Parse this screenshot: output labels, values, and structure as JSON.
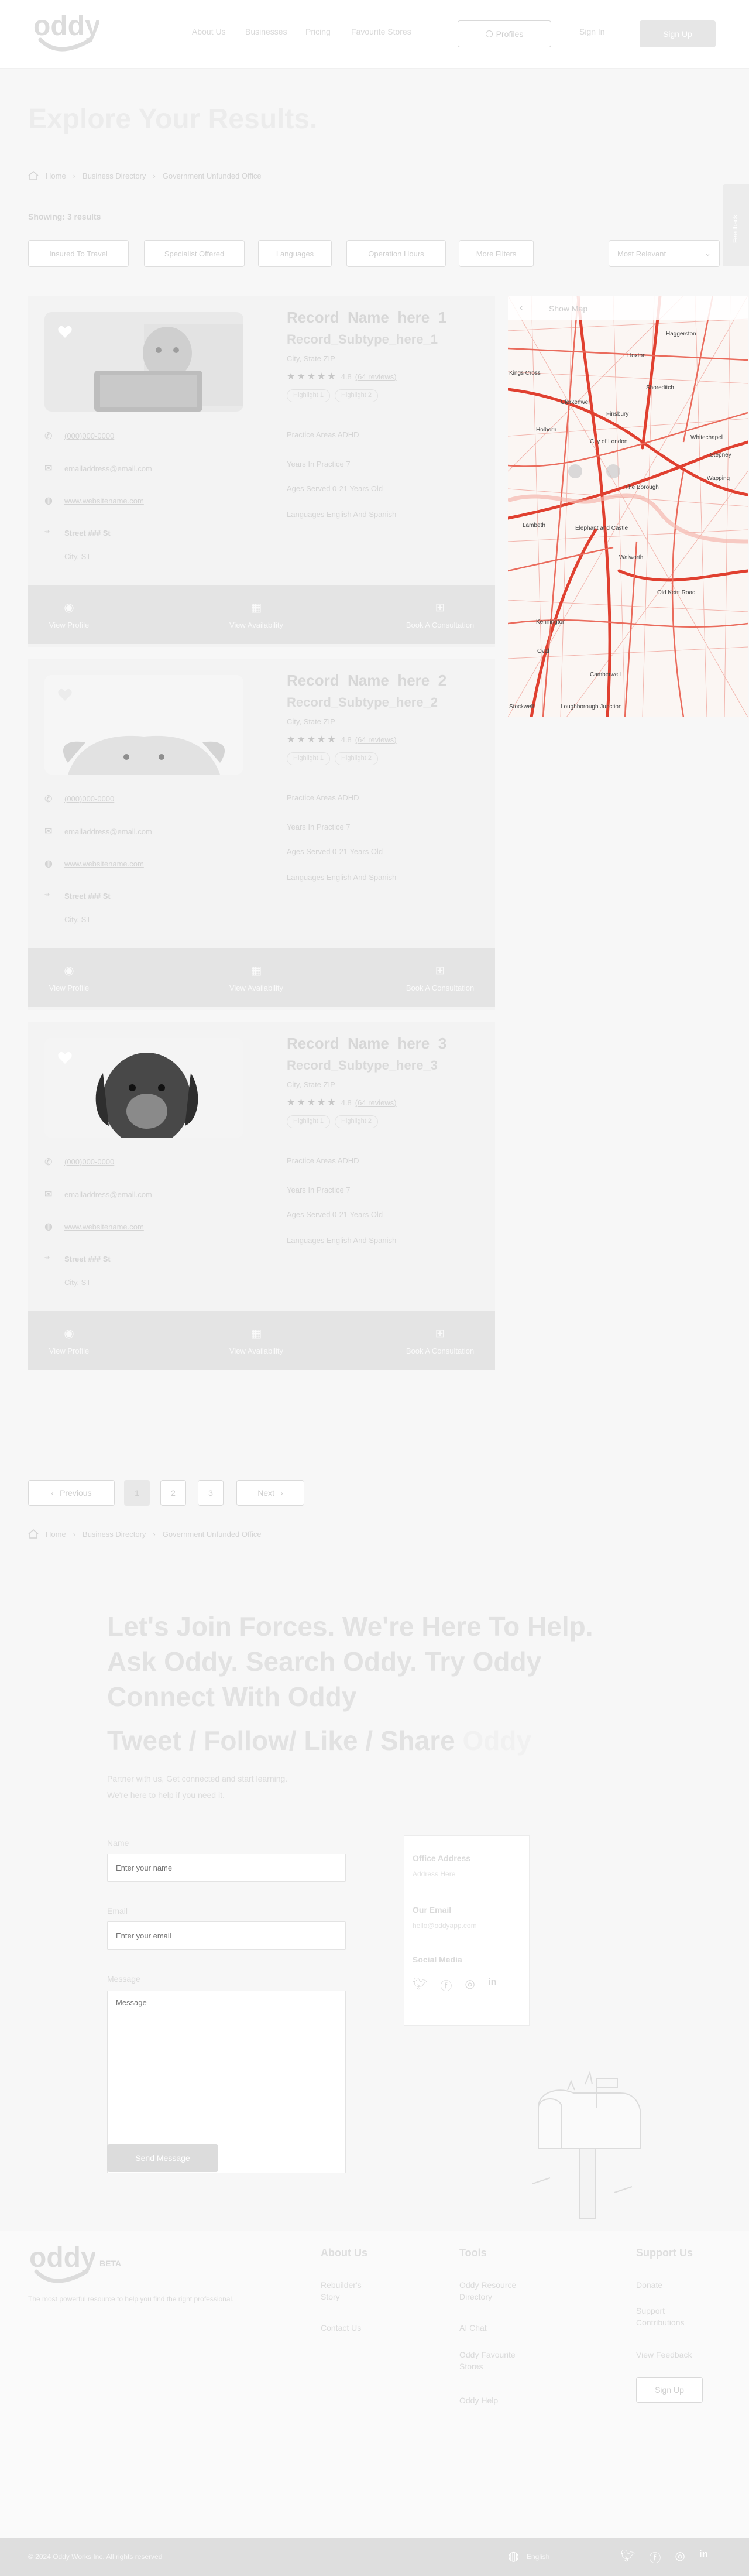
{
  "header": {
    "logo_text": "oddy",
    "nav": [
      "About Us",
      "Businesses",
      "Pricing",
      "Favourite Stores"
    ],
    "profiles_button": "Profiles",
    "signin": "Sign In",
    "signup": "Sign Up"
  },
  "page_title": "Explore Your Results.",
  "breadcrumb": [
    "Home",
    "Business Directory",
    "Government Unfunded Office"
  ],
  "feedback_label": "Feedback",
  "showing": "Showing: 3 results",
  "filters": [
    "Insured To Travel",
    "Specialist Offered",
    "Languages",
    "Operation Hours",
    "More Filters"
  ],
  "sort_label": "Most Relevant",
  "map": {
    "show_map": "Show Map",
    "places": [
      "Hoxton",
      "Haggerston",
      "Shoreditch",
      "Clerkenwell",
      "Finsbury",
      "Whitechapel",
      "City of London",
      "Holborn",
      "Stepney",
      "Wapping",
      "The Borough",
      "Lambeth",
      "Elephant and Castle",
      "Walworth",
      "Old Kent Road",
      "Kennington",
      "Oval",
      "Camberwell",
      "Loughborough Junction",
      "Stockwell",
      "Kings Cross"
    ]
  },
  "records": [
    {
      "name": "Record_Name_here_1",
      "subtype": "Record_Subtype_here_1",
      "location": "City, State ZIP",
      "rating": "4.8",
      "reviews": "(64 reviews)",
      "tags": [
        "Highlight 1",
        "Highlight 2"
      ],
      "practice_areas": "Practice Areas  ADHD",
      "years": "Years In Practice  7",
      "ages": "Ages Served  0-21 Years Old",
      "languages": "Languages  English And Spanish",
      "phone": "(000)000-0000",
      "email": "emailaddress@email.com",
      "website": "www.websitename.com",
      "street": "Street ### St",
      "city": "City, ST",
      "actions": [
        "View Profile",
        "View Availability",
        "Book A Consultation"
      ]
    },
    {
      "name": "Record_Name_here_2",
      "subtype": "Record_Subtype_here_2",
      "location": "City, State ZIP",
      "rating": "4.8",
      "reviews": "(64 reviews)",
      "tags": [
        "Highlight 1",
        "Highlight 2"
      ],
      "practice_areas": "Practice Areas  ADHD",
      "years": "Years In Practice  7",
      "ages": "Ages Served  0-21 Years Old",
      "languages": "Languages  English And Spanish",
      "phone": "(000)000-0000",
      "email": "emailaddress@email.com",
      "website": "www.websitename.com",
      "street": "Street ### St",
      "city": "City, ST",
      "actions": [
        "View Profile",
        "View Availability",
        "Book A Consultation"
      ]
    },
    {
      "name": "Record_Name_here_3",
      "subtype": "Record_Subtype_here_3",
      "location": "City, State ZIP",
      "rating": "4.8",
      "reviews": "(64 reviews)",
      "tags": [
        "Highlight 1",
        "Highlight 2"
      ],
      "practice_areas": "Practice Areas  ADHD",
      "years": "Years In Practice  7",
      "ages": "Ages Served  0-21 Years Old",
      "languages": "Languages  English And Spanish",
      "phone": "(000)000-0000",
      "email": "emailaddress@email.com",
      "website": "www.websitename.com",
      "street": "Street ### St",
      "city": "City, ST",
      "actions": [
        "View Profile",
        "View Availability",
        "Book A Consultation"
      ]
    }
  ],
  "pagination": {
    "prev": "Previous",
    "pages": [
      "1",
      "2",
      "3"
    ],
    "next": "Next",
    "current": "1"
  },
  "join": {
    "line1": "Let's Join Forces. We're Here To Help.",
    "line2": "Ask Oddy. Search Oddy. Try Oddy",
    "line3": "Connect With Oddy",
    "line4a": "Tweet / Follow/ Like / Share",
    "line4b": "Oddy",
    "sub1": "Partner with us, Get connected and start learning.",
    "sub2": "We're here to help if you need it.",
    "name_label": "Name",
    "name_placeholder": "Enter your name",
    "email_label": "Email",
    "email_placeholder": "Enter your email",
    "message_label": "Message",
    "message_placeholder": "Message",
    "send": "Send Message",
    "office_label": "Office Address",
    "office_value": "Address Here",
    "email_head": "Our Email",
    "email_value": "hello@oddyapp.com",
    "social_label": "Social Media"
  },
  "footer": {
    "logo_text": "oddy",
    "beta": "BETA",
    "tagline": "The most powerful resource to help you find the right professional.",
    "about": {
      "title": "About Us",
      "links": [
        "Rebuilder's Story",
        "Contact Us"
      ]
    },
    "tools": {
      "title": "Tools",
      "links": [
        "Oddy Resource Directory",
        "AI Chat",
        "Oddy Favourite Stores",
        "Oddy Help"
      ]
    },
    "support": {
      "title": "Support Us",
      "links": [
        "Donate",
        "Support Contributions",
        "View Feedback"
      ],
      "signup": "Sign Up"
    },
    "copyright": "© 2024 Oddy Works Inc. All rights reserved",
    "language": "English"
  }
}
